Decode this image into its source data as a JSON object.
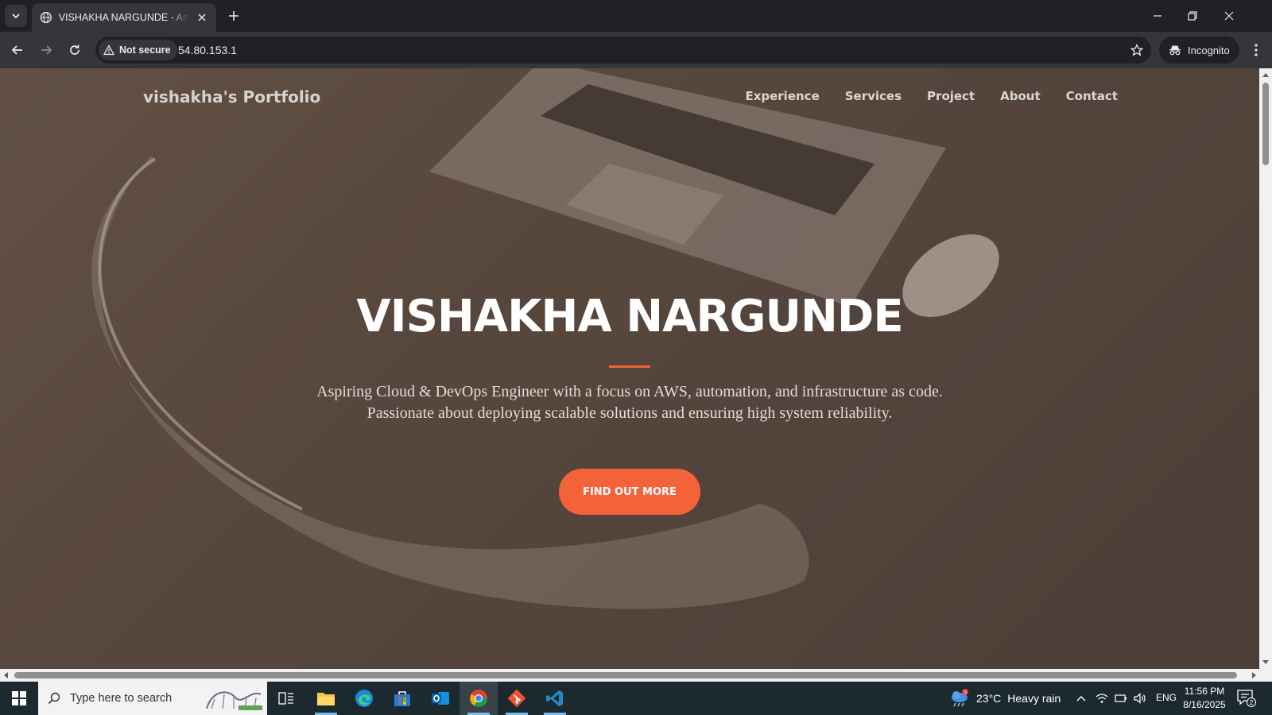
{
  "browser": {
    "tab_title": "VISHAKHA NARGUNDE - Aspiring Cloud & DevOps Engineer",
    "security_label": "Not secure",
    "url": "54.80.153.1",
    "incognito_label": "Incognito"
  },
  "page": {
    "brand": "vishakha's Portfolio",
    "nav": [
      "Experience",
      "Services",
      "Project",
      "About",
      "Contact"
    ],
    "hero_title": "VISHAKHA NARGUNDE",
    "hero_subtitle": "Aspiring Cloud & DevOps Engineer with a focus on AWS, automation, and infrastructure as code. Passionate about deploying scalable solutions and ensuring high system reliability.",
    "cta_label": "FIND OUT MORE",
    "accent_color": "#f4623a"
  },
  "taskbar": {
    "search_placeholder": "Type here to search",
    "apps": [
      "task-view-icon",
      "file-explorer-icon",
      "edge-icon",
      "store-icon",
      "outlook-icon",
      "chrome-icon",
      "git-icon",
      "vscode-icon"
    ],
    "weather_badge": "3",
    "temperature": "23°C",
    "weather": "Heavy rain",
    "language": "ENG",
    "time": "11:56 PM",
    "date": "8/16/2025",
    "notification_count": "2"
  }
}
